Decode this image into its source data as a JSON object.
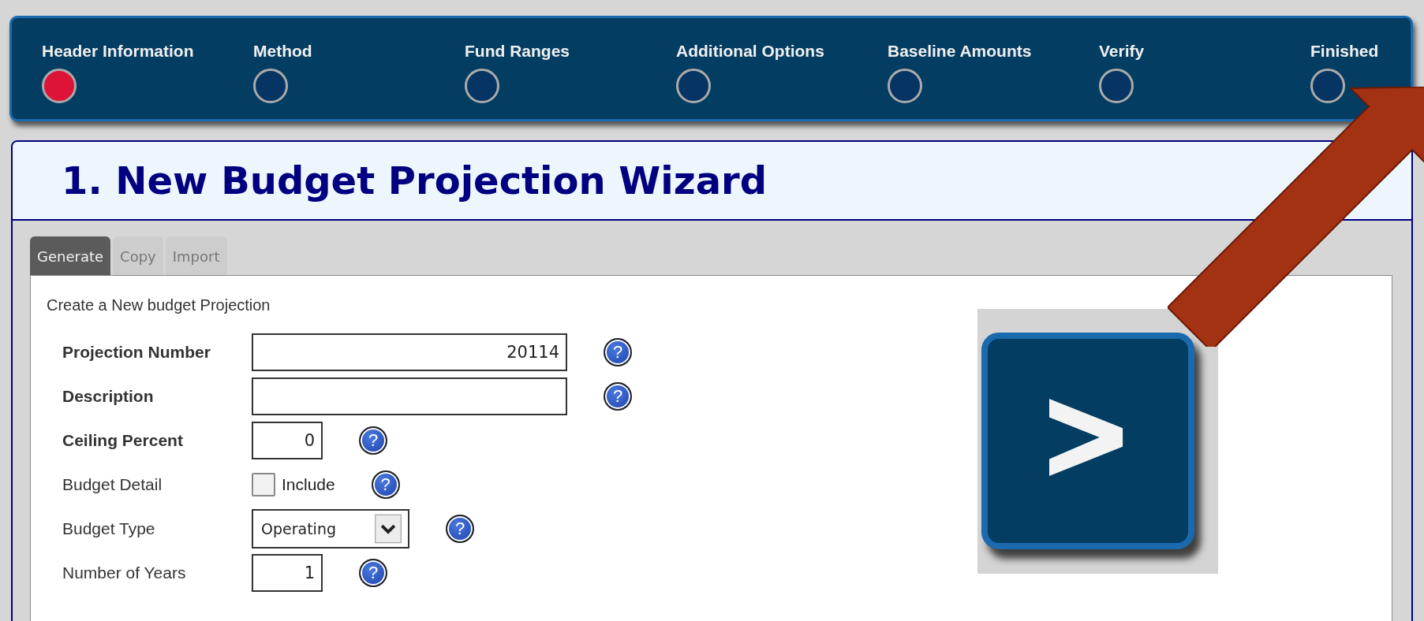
{
  "steps": [
    {
      "label": "Header Information",
      "selected": true
    },
    {
      "label": "Method",
      "selected": false
    },
    {
      "label": "Fund Ranges",
      "selected": false
    },
    {
      "label": "Additional Options",
      "selected": false
    },
    {
      "label": "Baseline Amounts",
      "selected": false
    },
    {
      "label": "Verify",
      "selected": false
    },
    {
      "label": "Finished",
      "selected": false
    }
  ],
  "title": "1. New Budget Projection Wizard",
  "tabs": [
    {
      "label": "Generate",
      "selected": true
    },
    {
      "label": "Copy",
      "selected": false
    },
    {
      "label": "Import",
      "selected": false
    }
  ],
  "intro": "Create a New budget Projection",
  "fields": [
    {
      "kind": "text",
      "label": "Projection Number",
      "required": true,
      "value": "20114",
      "help": "?"
    },
    {
      "kind": "text",
      "label": "Description",
      "required": true,
      "help": "?"
    },
    {
      "kind": "number",
      "label": "Ceiling Percent",
      "required": true,
      "value": "0",
      "help": "?"
    },
    {
      "kind": "checkbox",
      "label": "Budget Detail",
      "required": false,
      "option": "Include",
      "checked": false,
      "help": "?"
    },
    {
      "kind": "select",
      "label": "Budget Type",
      "required": false,
      "value": "Operating",
      "help": "?"
    },
    {
      "kind": "number",
      "label": "Number of Years",
      "required": false,
      "value": "1",
      "help": "?"
    }
  ]
}
